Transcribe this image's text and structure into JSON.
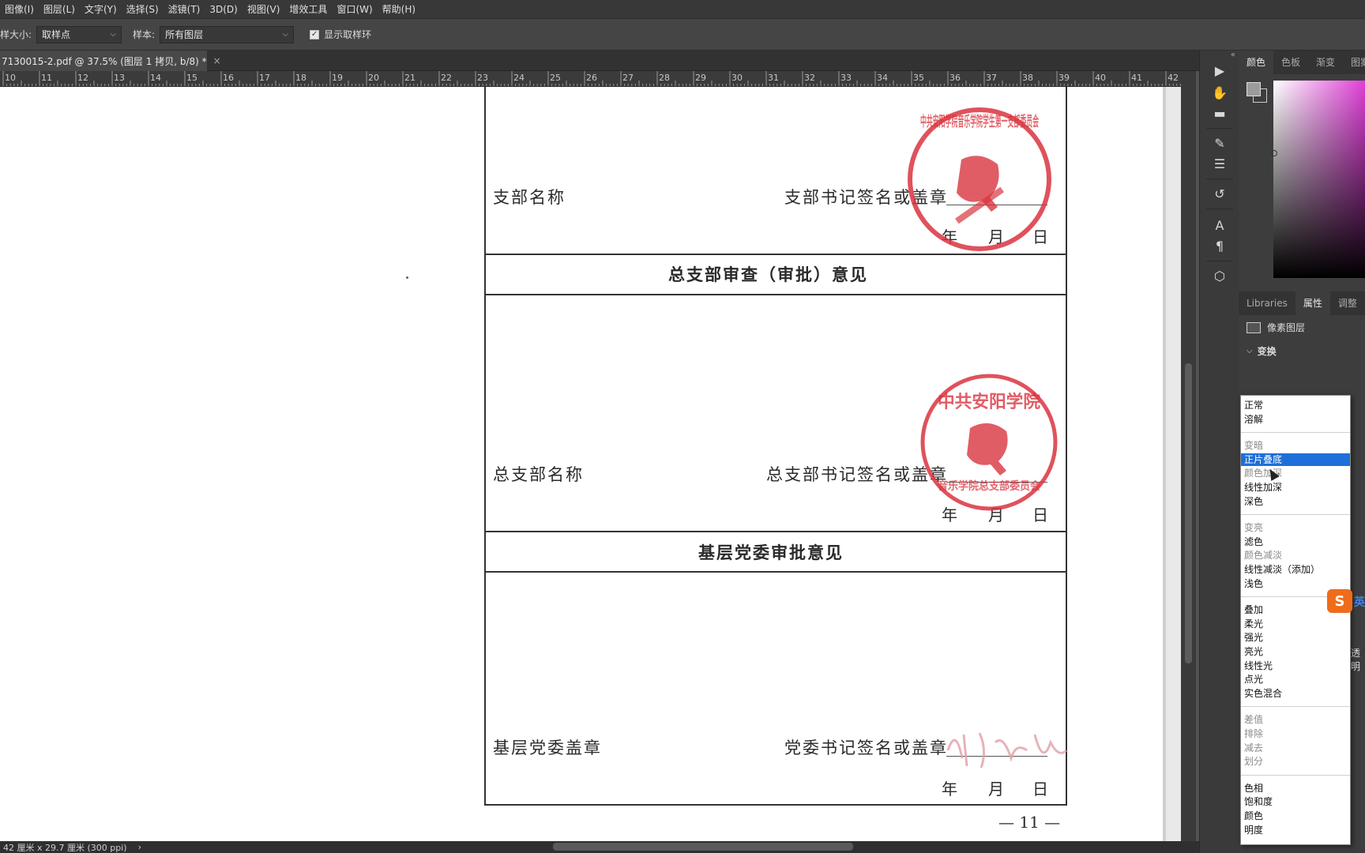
{
  "menu": [
    "图像(I)",
    "图层(L)",
    "文字(Y)",
    "选择(S)",
    "滤镜(T)",
    "3D(D)",
    "视图(V)",
    "增效工具",
    "窗口(W)",
    "帮助(H)"
  ],
  "options": {
    "sample_size_label": "样大小:",
    "sample_size_value": "取样点",
    "sample_label": "样本:",
    "sample_value": "所有图层",
    "show_ring_label": "显示取样环"
  },
  "doc_tab": {
    "title": "7130015-2.pdf @ 37.5% (图层 1 拷贝, b/8) *",
    "close": "×"
  },
  "ruler": [
    "10",
    "11",
    "12",
    "13",
    "14",
    "15",
    "16",
    "17",
    "18",
    "19",
    "20",
    "21",
    "22",
    "23",
    "24",
    "25",
    "26",
    "27",
    "28",
    "29",
    "30",
    "31",
    "32",
    "33",
    "34",
    "35",
    "36",
    "37",
    "38",
    "39",
    "40",
    "41",
    "42"
  ],
  "form": {
    "branch_name": "支部名称",
    "branch_secretary": "支部书记签名或盖章",
    "general_review_title": "总支部审查（审批）意见",
    "general_name": "总支部名称",
    "general_secretary": "总支部书记签名或盖章",
    "committee_title": "基层党委审批意见",
    "committee_seal": "基层党委盖章",
    "committee_secretary": "党委书记签名或盖章",
    "year": "年",
    "month": "月",
    "day": "日",
    "page_number": "— 11 —",
    "seal1_text": "中共安阳学院音乐学院学生第一支部委员会",
    "seal2_top": "中共安阳学院",
    "seal2_bottom": "音乐学院总支部委员会"
  },
  "status": {
    "doc_size": "42 厘米 x 29.7 厘米 (300 ppi)",
    "arrow": "›"
  },
  "panels": {
    "color_tabs": [
      "颜色",
      "色板",
      "渐变",
      "图案"
    ],
    "prop_tabs": [
      "Libraries",
      "属性",
      "调整"
    ],
    "layer_type": "像素图层",
    "transform": "变换"
  },
  "blend_modes": {
    "selected": "正片叠底",
    "groups": [
      [
        {
          "label": "正常"
        },
        {
          "label": "溶解"
        }
      ],
      [
        {
          "label": "变暗",
          "dim": true
        },
        {
          "label": "正片叠底"
        },
        {
          "label": "颜色加深",
          "dim": true
        },
        {
          "label": "线性加深"
        },
        {
          "label": "深色"
        }
      ],
      [
        {
          "label": "变亮",
          "dim": true
        },
        {
          "label": "滤色"
        },
        {
          "label": "颜色减淡",
          "dim": true
        },
        {
          "label": "线性减淡（添加）"
        },
        {
          "label": "浅色"
        }
      ],
      [
        {
          "label": "叠加"
        },
        {
          "label": "柔光"
        },
        {
          "label": "强光"
        },
        {
          "label": "亮光"
        },
        {
          "label": "线性光"
        },
        {
          "label": "点光"
        },
        {
          "label": "实色混合"
        }
      ],
      [
        {
          "label": "差值",
          "dim": true
        },
        {
          "label": "排除",
          "dim": true
        },
        {
          "label": "减去",
          "dim": true
        },
        {
          "label": "划分",
          "dim": true
        }
      ],
      [
        {
          "label": "色相"
        },
        {
          "label": "饱和度"
        },
        {
          "label": "颜色"
        },
        {
          "label": "明度"
        }
      ]
    ]
  },
  "ime": {
    "badge": "S",
    "text": "英"
  },
  "side_labels": {
    "opacity_cut": "透明"
  },
  "colors": {
    "seal_red": "#d9343f",
    "selection_blue": "#1e6fd9"
  }
}
